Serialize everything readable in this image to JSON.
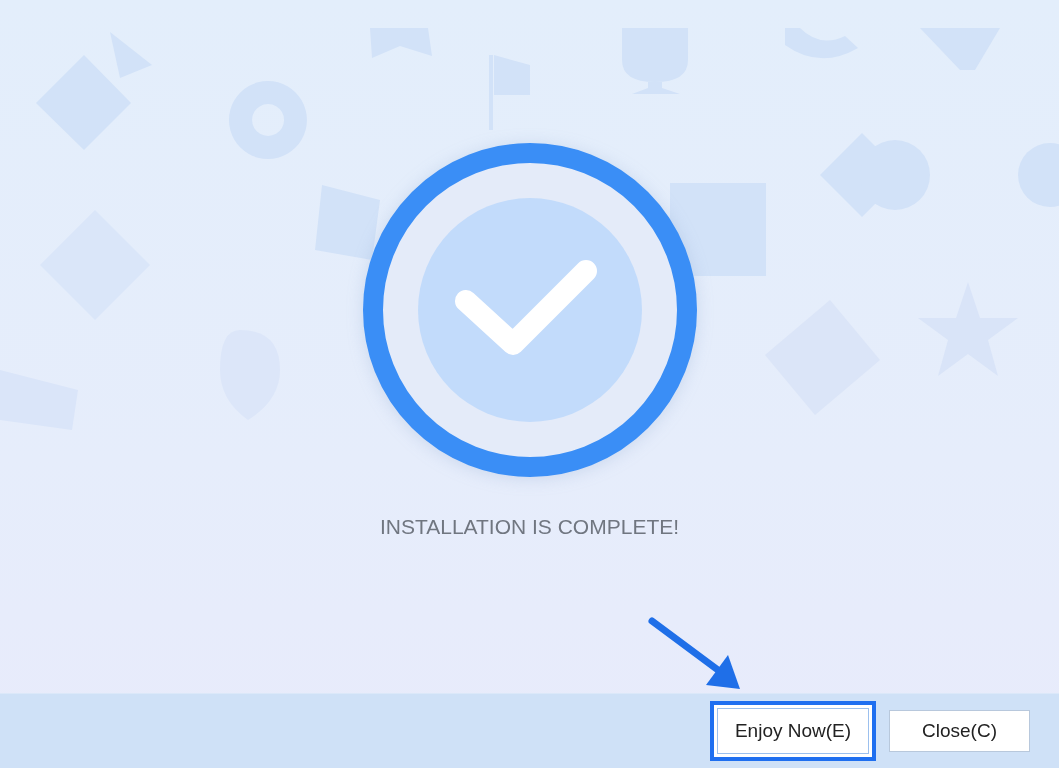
{
  "status": {
    "kind": "success",
    "message": "INSTALLATION IS COMPLETE!"
  },
  "buttons": [
    {
      "label": "Enjoy Now(E)",
      "highlighted": true
    },
    {
      "label": "Close(C)",
      "highlighted": false
    }
  ],
  "annotation_arrow": true
}
